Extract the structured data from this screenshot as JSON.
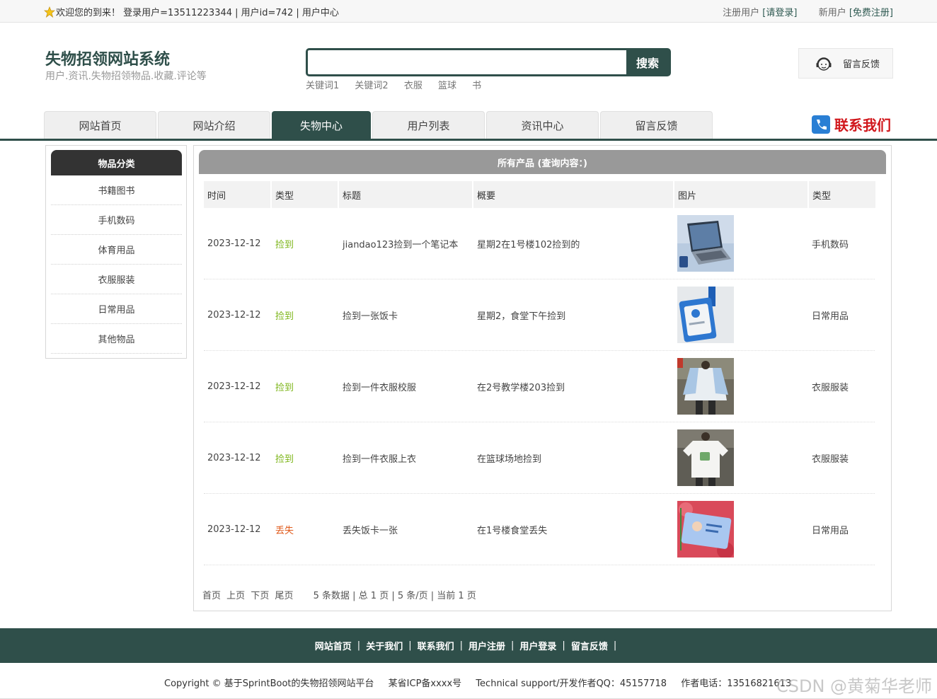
{
  "topbar": {
    "welcome": "欢迎您的到来！ 登录用户=13511223344 | 用户id=742 | 用户中心",
    "register_prefix": "注册用户",
    "login_link": "[请登录]",
    "new_user_prefix": "新用户",
    "register_link": "[免费注册]"
  },
  "brand": {
    "title": "失物招领网站系统",
    "subtitle": "用户.资讯.失物招领物品.收藏.评论等"
  },
  "search": {
    "value": "",
    "button": "搜索",
    "keywords": [
      "关键词1",
      "关键词2",
      "衣服",
      "篮球",
      "书"
    ]
  },
  "feedback_button": "留言反馈",
  "nav": {
    "items": [
      "网站首页",
      "网站介绍",
      "失物中心",
      "用户列表",
      "资讯中心",
      "留言反馈"
    ],
    "active": "失物中心",
    "contact": "联系我们"
  },
  "sidebar": {
    "title": "物品分类",
    "categories": [
      "书籍图书",
      "手机数码",
      "体育用品",
      "衣服服装",
      "日常用品",
      "其他物品"
    ]
  },
  "main": {
    "title": "所有产品 (查询内容：)",
    "columns": [
      "时间",
      "类型",
      "标题",
      "概要",
      "图片",
      "类型"
    ],
    "rows": [
      {
        "date": "2023-12-12",
        "type": "捡到",
        "title": "jiandao123捡到一个笔记本",
        "summary": "星期2在1号楼102捡到的",
        "image": "laptop",
        "category": "手机数码"
      },
      {
        "date": "2023-12-12",
        "type": "捡到",
        "title": "捡到一张饭卡",
        "summary": "星期2，食堂下午捡到",
        "image": "id-card",
        "category": "日常用品"
      },
      {
        "date": "2023-12-12",
        "type": "捡到",
        "title": "捡到一件衣服校服",
        "summary": "在2号教学楼203捡到",
        "image": "jacket",
        "category": "衣服服装"
      },
      {
        "date": "2023-12-12",
        "type": "捡到",
        "title": "捡到一件衣服上衣",
        "summary": "在篮球场地捡到",
        "image": "tshirt",
        "category": "衣服服装"
      },
      {
        "date": "2023-12-12",
        "type": "丢失",
        "title": "丢失饭卡一张",
        "summary": "在1号楼食堂丢失",
        "image": "meal-card",
        "category": "日常用品"
      }
    ],
    "pager": {
      "first": "首页",
      "prev": "上页",
      "next": "下页",
      "last": "尾页",
      "info": "5 条数据 | 总 1 页 | 5 条/页 | 当前 1 页"
    }
  },
  "footer": {
    "links": [
      "网站首页",
      "关于我们",
      "联系我们",
      "用户注册",
      "用户登录",
      "留言反馈"
    ],
    "separator": "|",
    "copyright": "Copyright © 基于SprintBoot的失物招领网站平台",
    "icp": "某省ICP备xxxx号",
    "support": "Technical support/开发作者QQ：45157718",
    "phone": "作者电话：13516821613",
    "watermark": "CSDN @黄菊华老师"
  },
  "colors": {
    "primary": "#2f4f4a",
    "found": "#7cb518",
    "lost": "#e05a1b",
    "contact": "#d1171c"
  }
}
